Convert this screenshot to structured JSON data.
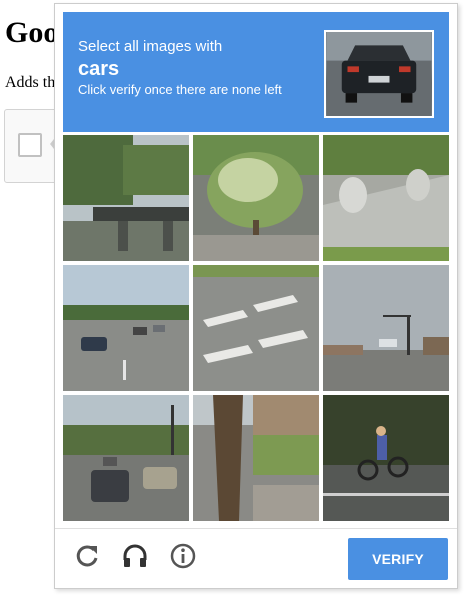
{
  "page": {
    "title": "Goo",
    "text": "Adds th"
  },
  "challenge": {
    "instruction_line1": "Select all images with",
    "target": "cars",
    "instruction_line3": "Click verify once there are none left",
    "tiles": [
      {
        "subject": "bridge-overpass"
      },
      {
        "subject": "shrub"
      },
      {
        "subject": "sidewalk-planters"
      },
      {
        "subject": "highway-with-cars"
      },
      {
        "subject": "crosswalk"
      },
      {
        "subject": "intersection-traffic-light"
      },
      {
        "subject": "street-with-cars"
      },
      {
        "subject": "palm-trunk"
      },
      {
        "subject": "cyclist"
      }
    ],
    "verify_label": "VERIFY",
    "icons": {
      "reload": "reload-icon",
      "audio": "headphones-icon",
      "info": "info-icon"
    }
  },
  "colors": {
    "accent": "#4a90e2",
    "icon": "#555555"
  }
}
